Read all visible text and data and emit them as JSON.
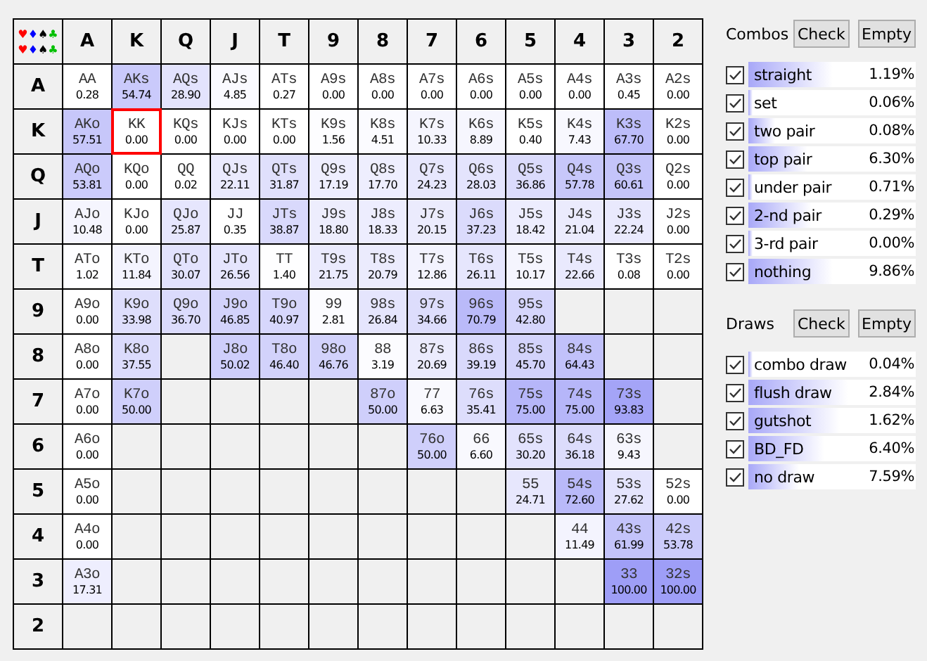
{
  "grid": {
    "corner": [
      [
        {
          "symbol": "♥",
          "color": "#ff0000"
        },
        {
          "symbol": "♦",
          "color": "#0000ff"
        },
        {
          "symbol": "♠",
          "color": "#000000"
        },
        {
          "symbol": "♣",
          "color": "#00c000"
        }
      ],
      [
        {
          "symbol": "♥",
          "color": "#ff0000"
        },
        {
          "symbol": "♦",
          "color": "#0000ff"
        },
        {
          "symbol": "♠",
          "color": "#000000"
        },
        {
          "symbol": "♣",
          "color": "#00c000"
        }
      ]
    ],
    "columns": [
      "A",
      "K",
      "Q",
      "J",
      "T",
      "9",
      "8",
      "7",
      "6",
      "5",
      "4",
      "3",
      "2"
    ],
    "rows": [
      {
        "header": "A",
        "cells": [
          {
            "kind": "hand",
            "hand": "AA",
            "value": "0.28",
            "selected": false
          },
          {
            "kind": "hand",
            "hand": "AKs",
            "value": "54.74",
            "selected": false
          },
          {
            "kind": "hand",
            "hand": "AQs",
            "value": "28.90",
            "selected": false
          },
          {
            "kind": "hand",
            "hand": "AJs",
            "value": "4.85",
            "selected": false
          },
          {
            "kind": "hand",
            "hand": "ATs",
            "value": "0.27",
            "selected": false
          },
          {
            "kind": "hand",
            "hand": "A9s",
            "value": "0.00",
            "selected": false
          },
          {
            "kind": "hand",
            "hand": "A8s",
            "value": "0.00",
            "selected": false
          },
          {
            "kind": "hand",
            "hand": "A7s",
            "value": "0.00",
            "selected": false
          },
          {
            "kind": "hand",
            "hand": "A6s",
            "value": "0.00",
            "selected": false
          },
          {
            "kind": "hand",
            "hand": "A5s",
            "value": "0.00",
            "selected": false
          },
          {
            "kind": "hand",
            "hand": "A4s",
            "value": "0.00",
            "selected": false
          },
          {
            "kind": "hand",
            "hand": "A3s",
            "value": "0.45",
            "selected": false
          },
          {
            "kind": "hand",
            "hand": "A2s",
            "value": "0.00",
            "selected": false
          }
        ]
      },
      {
        "header": "K",
        "cells": [
          {
            "kind": "hand",
            "hand": "AKo",
            "value": "57.51",
            "selected": false
          },
          {
            "kind": "hand",
            "hand": "KK",
            "value": "0.00",
            "selected": true
          },
          {
            "kind": "hand",
            "hand": "KQs",
            "value": "0.00",
            "selected": false
          },
          {
            "kind": "hand",
            "hand": "KJs",
            "value": "0.00",
            "selected": false
          },
          {
            "kind": "hand",
            "hand": "KTs",
            "value": "0.00",
            "selected": false
          },
          {
            "kind": "hand",
            "hand": "K9s",
            "value": "1.56",
            "selected": false
          },
          {
            "kind": "hand",
            "hand": "K8s",
            "value": "4.51",
            "selected": false
          },
          {
            "kind": "hand",
            "hand": "K7s",
            "value": "10.33",
            "selected": false
          },
          {
            "kind": "hand",
            "hand": "K6s",
            "value": "8.89",
            "selected": false
          },
          {
            "kind": "hand",
            "hand": "K5s",
            "value": "0.40",
            "selected": false
          },
          {
            "kind": "hand",
            "hand": "K4s",
            "value": "7.43",
            "selected": false
          },
          {
            "kind": "hand",
            "hand": "K3s",
            "value": "67.70",
            "selected": false
          },
          {
            "kind": "hand",
            "hand": "K2s",
            "value": "0.00",
            "selected": false
          }
        ]
      },
      {
        "header": "Q",
        "cells": [
          {
            "kind": "hand",
            "hand": "AQo",
            "value": "53.81",
            "selected": false
          },
          {
            "kind": "hand",
            "hand": "KQo",
            "value": "0.00",
            "selected": false
          },
          {
            "kind": "hand",
            "hand": "QQ",
            "value": "0.02",
            "selected": false
          },
          {
            "kind": "hand",
            "hand": "QJs",
            "value": "22.11",
            "selected": false
          },
          {
            "kind": "hand",
            "hand": "QTs",
            "value": "31.87",
            "selected": false
          },
          {
            "kind": "hand",
            "hand": "Q9s",
            "value": "17.19",
            "selected": false
          },
          {
            "kind": "hand",
            "hand": "Q8s",
            "value": "17.70",
            "selected": false
          },
          {
            "kind": "hand",
            "hand": "Q7s",
            "value": "24.23",
            "selected": false
          },
          {
            "kind": "hand",
            "hand": "Q6s",
            "value": "28.03",
            "selected": false
          },
          {
            "kind": "hand",
            "hand": "Q5s",
            "value": "36.86",
            "selected": false
          },
          {
            "kind": "hand",
            "hand": "Q4s",
            "value": "57.78",
            "selected": false
          },
          {
            "kind": "hand",
            "hand": "Q3s",
            "value": "60.61",
            "selected": false
          },
          {
            "kind": "hand",
            "hand": "Q2s",
            "value": "0.00",
            "selected": false
          }
        ]
      },
      {
        "header": "J",
        "cells": [
          {
            "kind": "hand",
            "hand": "AJo",
            "value": "10.48",
            "selected": false
          },
          {
            "kind": "hand",
            "hand": "KJo",
            "value": "0.00",
            "selected": false
          },
          {
            "kind": "hand",
            "hand": "QJo",
            "value": "25.87",
            "selected": false
          },
          {
            "kind": "hand",
            "hand": "JJ",
            "value": "0.35",
            "selected": false
          },
          {
            "kind": "hand",
            "hand": "JTs",
            "value": "38.87",
            "selected": false
          },
          {
            "kind": "hand",
            "hand": "J9s",
            "value": "18.80",
            "selected": false
          },
          {
            "kind": "hand",
            "hand": "J8s",
            "value": "18.33",
            "selected": false
          },
          {
            "kind": "hand",
            "hand": "J7s",
            "value": "20.15",
            "selected": false
          },
          {
            "kind": "hand",
            "hand": "J6s",
            "value": "37.23",
            "selected": false
          },
          {
            "kind": "hand",
            "hand": "J5s",
            "value": "18.42",
            "selected": false
          },
          {
            "kind": "hand",
            "hand": "J4s",
            "value": "21.04",
            "selected": false
          },
          {
            "kind": "hand",
            "hand": "J3s",
            "value": "22.24",
            "selected": false
          },
          {
            "kind": "hand",
            "hand": "J2s",
            "value": "0.00",
            "selected": false
          }
        ]
      },
      {
        "header": "T",
        "cells": [
          {
            "kind": "hand",
            "hand": "ATo",
            "value": "1.02",
            "selected": false
          },
          {
            "kind": "hand",
            "hand": "KTo",
            "value": "11.84",
            "selected": false
          },
          {
            "kind": "hand",
            "hand": "QTo",
            "value": "30.07",
            "selected": false
          },
          {
            "kind": "hand",
            "hand": "JTo",
            "value": "26.56",
            "selected": false
          },
          {
            "kind": "hand",
            "hand": "TT",
            "value": "1.40",
            "selected": false
          },
          {
            "kind": "hand",
            "hand": "T9s",
            "value": "21.75",
            "selected": false
          },
          {
            "kind": "hand",
            "hand": "T8s",
            "value": "20.79",
            "selected": false
          },
          {
            "kind": "hand",
            "hand": "T7s",
            "value": "12.86",
            "selected": false
          },
          {
            "kind": "hand",
            "hand": "T6s",
            "value": "26.11",
            "selected": false
          },
          {
            "kind": "hand",
            "hand": "T5s",
            "value": "10.17",
            "selected": false
          },
          {
            "kind": "hand",
            "hand": "T4s",
            "value": "22.66",
            "selected": false
          },
          {
            "kind": "hand",
            "hand": "T3s",
            "value": "0.08",
            "selected": false
          },
          {
            "kind": "hand",
            "hand": "T2s",
            "value": "0.00",
            "selected": false
          }
        ]
      },
      {
        "header": "9",
        "cells": [
          {
            "kind": "hand",
            "hand": "A9o",
            "value": "0.00",
            "selected": false
          },
          {
            "kind": "hand",
            "hand": "K9o",
            "value": "33.98",
            "selected": false
          },
          {
            "kind": "hand",
            "hand": "Q9o",
            "value": "36.70",
            "selected": false
          },
          {
            "kind": "hand",
            "hand": "J9o",
            "value": "46.85",
            "selected": false
          },
          {
            "kind": "hand",
            "hand": "T9o",
            "value": "40.97",
            "selected": false
          },
          {
            "kind": "hand",
            "hand": "99",
            "value": "2.81",
            "selected": false
          },
          {
            "kind": "hand",
            "hand": "98s",
            "value": "26.84",
            "selected": false
          },
          {
            "kind": "hand",
            "hand": "97s",
            "value": "34.66",
            "selected": false
          },
          {
            "kind": "hand",
            "hand": "96s",
            "value": "70.79",
            "selected": false
          },
          {
            "kind": "hand",
            "hand": "95s",
            "value": "42.80",
            "selected": false
          },
          {
            "kind": "blank"
          },
          {
            "kind": "blank"
          },
          {
            "kind": "blank"
          }
        ]
      },
      {
        "header": "8",
        "cells": [
          {
            "kind": "hand",
            "hand": "A8o",
            "value": "0.00",
            "selected": false
          },
          {
            "kind": "hand",
            "hand": "K8o",
            "value": "37.55",
            "selected": false
          },
          {
            "kind": "blank"
          },
          {
            "kind": "hand",
            "hand": "J8o",
            "value": "50.02",
            "selected": false
          },
          {
            "kind": "hand",
            "hand": "T8o",
            "value": "46.40",
            "selected": false
          },
          {
            "kind": "hand",
            "hand": "98o",
            "value": "46.76",
            "selected": false
          },
          {
            "kind": "hand",
            "hand": "88",
            "value": "3.19",
            "selected": false
          },
          {
            "kind": "hand",
            "hand": "87s",
            "value": "20.69",
            "selected": false
          },
          {
            "kind": "hand",
            "hand": "86s",
            "value": "39.19",
            "selected": false
          },
          {
            "kind": "hand",
            "hand": "85s",
            "value": "45.70",
            "selected": false
          },
          {
            "kind": "hand",
            "hand": "84s",
            "value": "64.43",
            "selected": false
          },
          {
            "kind": "blank"
          },
          {
            "kind": "blank"
          }
        ]
      },
      {
        "header": "7",
        "cells": [
          {
            "kind": "hand",
            "hand": "A7o",
            "value": "0.00",
            "selected": false
          },
          {
            "kind": "hand",
            "hand": "K7o",
            "value": "50.00",
            "selected": false
          },
          {
            "kind": "blank"
          },
          {
            "kind": "blank"
          },
          {
            "kind": "blank"
          },
          {
            "kind": "blank"
          },
          {
            "kind": "hand",
            "hand": "87o",
            "value": "50.00",
            "selected": false
          },
          {
            "kind": "hand",
            "hand": "77",
            "value": "6.63",
            "selected": false
          },
          {
            "kind": "hand",
            "hand": "76s",
            "value": "35.41",
            "selected": false
          },
          {
            "kind": "hand",
            "hand": "75s",
            "value": "75.00",
            "selected": false
          },
          {
            "kind": "hand",
            "hand": "74s",
            "value": "75.00",
            "selected": false
          },
          {
            "kind": "hand",
            "hand": "73s",
            "value": "93.83",
            "selected": false
          },
          {
            "kind": "blank"
          }
        ]
      },
      {
        "header": "6",
        "cells": [
          {
            "kind": "hand",
            "hand": "A6o",
            "value": "0.00",
            "selected": false
          },
          {
            "kind": "blank"
          },
          {
            "kind": "blank"
          },
          {
            "kind": "blank"
          },
          {
            "kind": "blank"
          },
          {
            "kind": "blank"
          },
          {
            "kind": "blank"
          },
          {
            "kind": "hand",
            "hand": "76o",
            "value": "50.00",
            "selected": false
          },
          {
            "kind": "hand",
            "hand": "66",
            "value": "6.60",
            "selected": false
          },
          {
            "kind": "hand",
            "hand": "65s",
            "value": "30.20",
            "selected": false
          },
          {
            "kind": "hand",
            "hand": "64s",
            "value": "36.18",
            "selected": false
          },
          {
            "kind": "hand",
            "hand": "63s",
            "value": "9.43",
            "selected": false
          },
          {
            "kind": "blank"
          }
        ]
      },
      {
        "header": "5",
        "cells": [
          {
            "kind": "hand",
            "hand": "A5o",
            "value": "0.00",
            "selected": false
          },
          {
            "kind": "blank"
          },
          {
            "kind": "blank"
          },
          {
            "kind": "blank"
          },
          {
            "kind": "blank"
          },
          {
            "kind": "blank"
          },
          {
            "kind": "blank"
          },
          {
            "kind": "blank"
          },
          {
            "kind": "blank"
          },
          {
            "kind": "hand",
            "hand": "55",
            "value": "24.71",
            "selected": false
          },
          {
            "kind": "hand",
            "hand": "54s",
            "value": "72.60",
            "selected": false
          },
          {
            "kind": "hand",
            "hand": "53s",
            "value": "27.62",
            "selected": false
          },
          {
            "kind": "hand",
            "hand": "52s",
            "value": "0.00",
            "selected": false
          }
        ]
      },
      {
        "header": "4",
        "cells": [
          {
            "kind": "hand",
            "hand": "A4o",
            "value": "0.00",
            "selected": false
          },
          {
            "kind": "blank"
          },
          {
            "kind": "blank"
          },
          {
            "kind": "blank"
          },
          {
            "kind": "blank"
          },
          {
            "kind": "blank"
          },
          {
            "kind": "blank"
          },
          {
            "kind": "blank"
          },
          {
            "kind": "blank"
          },
          {
            "kind": "blank"
          },
          {
            "kind": "hand",
            "hand": "44",
            "value": "11.49",
            "selected": false
          },
          {
            "kind": "hand",
            "hand": "43s",
            "value": "61.99",
            "selected": false
          },
          {
            "kind": "hand",
            "hand": "42s",
            "value": "53.78",
            "selected": false
          }
        ]
      },
      {
        "header": "3",
        "cells": [
          {
            "kind": "hand",
            "hand": "A3o",
            "value": "17.31",
            "selected": false
          },
          {
            "kind": "blank"
          },
          {
            "kind": "blank"
          },
          {
            "kind": "blank"
          },
          {
            "kind": "blank"
          },
          {
            "kind": "blank"
          },
          {
            "kind": "blank"
          },
          {
            "kind": "blank"
          },
          {
            "kind": "blank"
          },
          {
            "kind": "blank"
          },
          {
            "kind": "blank"
          },
          {
            "kind": "hand",
            "hand": "33",
            "value": "100.00",
            "selected": false
          },
          {
            "kind": "hand",
            "hand": "32s",
            "value": "100.00",
            "selected": false
          }
        ]
      },
      {
        "header": "2",
        "cells": [
          {
            "kind": "blank"
          },
          {
            "kind": "blank"
          },
          {
            "kind": "blank"
          },
          {
            "kind": "blank"
          },
          {
            "kind": "blank"
          },
          {
            "kind": "blank"
          },
          {
            "kind": "blank"
          },
          {
            "kind": "blank"
          },
          {
            "kind": "blank"
          },
          {
            "kind": "blank"
          },
          {
            "kind": "blank"
          },
          {
            "kind": "blank"
          },
          {
            "kind": "blank"
          }
        ]
      }
    ]
  },
  "panels": [
    {
      "title": "Combos",
      "buttons": [
        "Check",
        "Empty"
      ],
      "items": [
        {
          "label": "straight",
          "checked": true,
          "level": 0.5,
          "value": "1.19%"
        },
        {
          "label": "set",
          "checked": true,
          "level": 0.02,
          "value": "0.06%"
        },
        {
          "label": "two pair",
          "checked": true,
          "level": 0.16,
          "value": "0.08%"
        },
        {
          "label": "top pair",
          "checked": true,
          "level": 0.35,
          "value": "6.30%"
        },
        {
          "label": "under pair",
          "checked": true,
          "level": 0.01,
          "value": "0.71%"
        },
        {
          "label": "2-nd pair",
          "checked": true,
          "level": 0.38,
          "value": "0.29%"
        },
        {
          "label": "3-rd pair",
          "checked": true,
          "level": 0.02,
          "value": "0.00%"
        },
        {
          "label": "nothing",
          "checked": true,
          "level": 0.5,
          "value": "9.86%"
        }
      ]
    },
    {
      "title": "Draws",
      "buttons": [
        "Check",
        "Empty"
      ],
      "items": [
        {
          "label": "combo draw",
          "checked": true,
          "level": 0.01,
          "value": "0.04%"
        },
        {
          "label": "flush draw",
          "checked": true,
          "level": 0.6,
          "value": "2.84%"
        },
        {
          "label": "gutshot",
          "checked": true,
          "level": 0.55,
          "value": "1.62%"
        },
        {
          "label": "BD_FD",
          "checked": true,
          "level": 0.45,
          "value": "6.40%"
        },
        {
          "label": "no draw",
          "checked": true,
          "level": 0.3,
          "value": "7.59%"
        }
      ]
    }
  ]
}
